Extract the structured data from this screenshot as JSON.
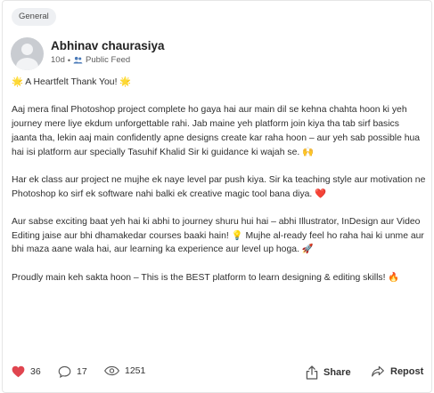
{
  "category_tag": "General",
  "author": {
    "name": "Abhinav chaurasiya",
    "time_ago": "10d",
    "separator": "•",
    "visibility": "Public Feed"
  },
  "post": {
    "paragraphs": [
      "🌟 A Heartfelt Thank You! 🌟",
      "Aaj mera final Photoshop project complete ho gaya hai aur main dil se kehna chahta hoon ki yeh journey mere liye ekdum unforgettable rahi. Jab maine yeh platform join kiya tha tab sirf basics jaanta tha, lekin aaj main confidently apne designs create kar raha hoon – aur yeh sab possible hua hai isi platform aur specially Tasuhif Khalid Sir ki guidance ki wajah se. 🙌",
      "Har ek class aur project ne mujhe ek naye level par push kiya. Sir ka teaching style aur motivation ne Photoshop ko sirf ek software nahi balki ek creative magic tool bana diya. ❤️",
      "Aur sabse exciting baat yeh hai ki abhi to journey shuru hui hai – abhi Illustrator, InDesign aur Video Editing jaise aur bhi dhamakedar courses baaki hain! 💡 Mujhe al-ready feel ho raha hai ki unme aur bhi maza aane wala hai, aur learning ka experience aur level up hoga. 🚀",
      "Proudly main keh sakta hoon – This is the BEST platform to learn designing & editing skills! 🔥"
    ]
  },
  "stats": {
    "likes": "36",
    "comments": "17",
    "views": "1251"
  },
  "actions": {
    "share_label": "Share",
    "repost_label": "Repost"
  },
  "colors": {
    "like_heart": "#e0454f",
    "icon_gray": "#555555"
  }
}
